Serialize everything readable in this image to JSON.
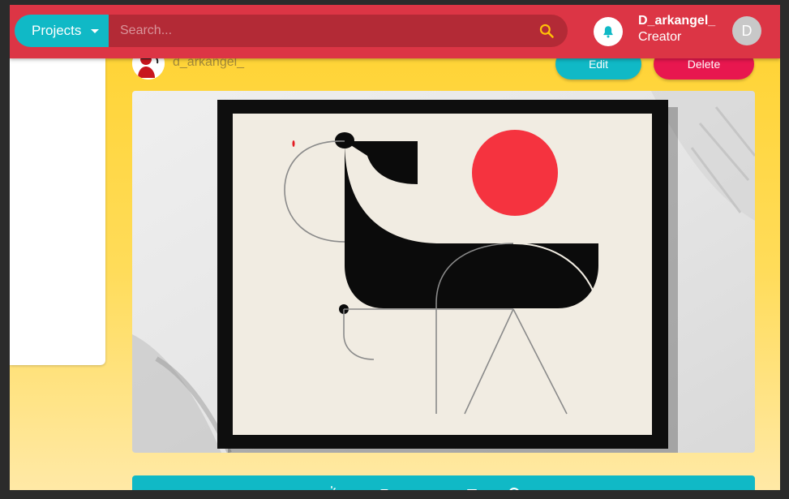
{
  "header": {
    "projects_label": "Projects",
    "search_placeholder": "Search...",
    "user_name": "D_arkangel_",
    "user_role": "Creator",
    "avatar_initial": "D"
  },
  "post": {
    "author": "d_arkangel_",
    "edit_label": "Edit",
    "delete_label": "Delete"
  },
  "colors": {
    "header_red": "#dc3545",
    "accent_teal": "#10b9c6",
    "delete_pink": "#e8174f",
    "background_yellow": "#ffd22e"
  },
  "icons": {
    "search": "search-icon",
    "bell": "bell-icon",
    "caret": "chevron-down-icon"
  }
}
